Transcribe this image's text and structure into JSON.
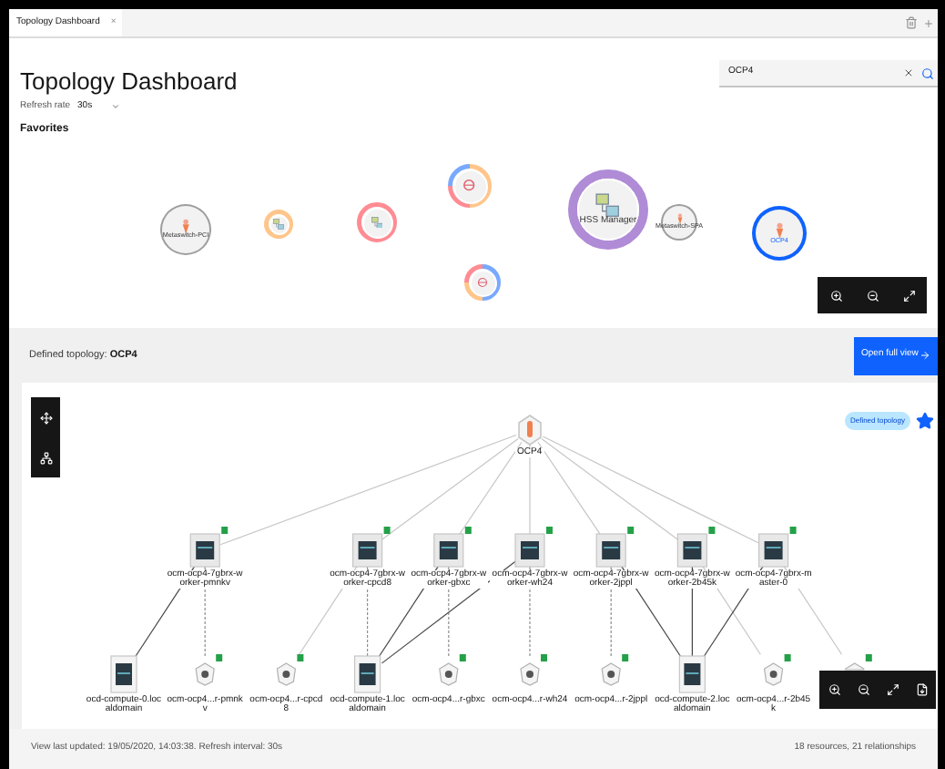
{
  "browser_tab": {
    "title": "Topology Dashboard",
    "close": "×"
  },
  "header": {
    "title": "Topology Dashboard",
    "refresh_label": "Refresh rate",
    "refresh_value": "30s"
  },
  "search": {
    "value": "OCP4"
  },
  "favorites": {
    "title": "Favorites",
    "items": [
      {
        "label": "Metaswitch-PCI",
        "kind": "cone",
        "selected": false
      },
      {
        "kind": "monitor",
        "ring": [
          {
            "color": "#ffc58a"
          }
        ],
        "selected": false
      },
      {
        "kind": "monitor",
        "ring": [
          {
            "color": "#ff8c93"
          }
        ],
        "selected": false
      },
      {
        "kind": "network",
        "ring": [
          {
            "color": "#ffc58a"
          },
          {
            "color": "#ffc58a"
          },
          {
            "color": "#ff8c93"
          },
          {
            "color": "#78a9ff"
          }
        ],
        "selected": false
      },
      {
        "kind": "network",
        "ring": [
          {
            "color": "#78a9ff"
          },
          {
            "color": "#78a9ff"
          },
          {
            "color": "#ffc58a"
          },
          {
            "color": "#ff8c93"
          }
        ],
        "selected": false
      },
      {
        "label": "HSS Manager",
        "kind": "monitor",
        "ring": [
          {
            "color": "#b08bd6"
          }
        ],
        "selected": false
      },
      {
        "label": "Metaswitch-SPA",
        "kind": "cone",
        "selected": false
      },
      {
        "label": "OCP4",
        "kind": "cone",
        "selected": true
      }
    ]
  },
  "topology": {
    "label": "Defined topology:",
    "name": "OCP4",
    "button": "Open full view",
    "badge": "Defined topology",
    "starred": true,
    "root": {
      "label": "OCP4"
    },
    "workers": [
      {
        "label": "ocm-ocp4-7gbrx-worker-pmnkv",
        "links": [
          {
            "kind": "solid"
          },
          {
            "kind": "dashed"
          }
        ]
      },
      {
        "label": "ocm-ocp4-7gbrx-worker-cpcd8",
        "links": [
          {
            "kind": "faint"
          },
          {
            "kind": "dashed"
          }
        ]
      },
      {
        "label": "ocm-ocp4-7gbrx-worker-gbxc",
        "links": [
          {
            "kind": "solid"
          },
          {
            "kind": "dashed"
          }
        ]
      },
      {
        "label": "ocm-ocp4-7gbrx-worker-wh24",
        "links": [
          {
            "kind": "solid"
          },
          {
            "kind": "dashed"
          }
        ]
      },
      {
        "label": "ocm-ocp4-7gbrx-worker-2jppl",
        "links": [
          {
            "kind": "dashed"
          },
          {
            "kind": "solid"
          }
        ]
      },
      {
        "label": "ocm-ocp4-7gbrx-worker-2b45k",
        "links": [
          {
            "kind": "solid"
          },
          {
            "kind": "faint"
          }
        ]
      },
      {
        "label": "ocm-ocp4-7gbrx-master-0",
        "links": [
          {
            "kind": "solid"
          },
          {
            "kind": "faint"
          }
        ]
      }
    ],
    "bottom": [
      {
        "kind": "compute",
        "label": "ocd-compute-0.localdomain"
      },
      {
        "kind": "pod",
        "label": "ocm-ocp4...r-pmnkv"
      },
      {
        "kind": "pod",
        "label": "ocm-ocp4...r-cpcd8"
      },
      {
        "kind": "compute",
        "label": "ocd-compute-1.localdomain"
      },
      {
        "kind": "pod",
        "label": "ocm-ocp4...r-gbxc"
      },
      {
        "kind": "pod",
        "label": "ocm-ocp4...r-wh24"
      },
      {
        "kind": "pod",
        "label": "ocm-ocp4...r-2jppl"
      },
      {
        "kind": "compute",
        "label": "ocd-compute-2.localdomain"
      },
      {
        "kind": "pod",
        "label": "ocm-ocp4...r-2b45k"
      },
      {
        "kind": "pod"
      }
    ]
  },
  "status_bar": {
    "left": "View last updated: 19/05/2020, 14:03:38. Refresh interval: 30s",
    "right": "18 resources, 21 relationships"
  }
}
